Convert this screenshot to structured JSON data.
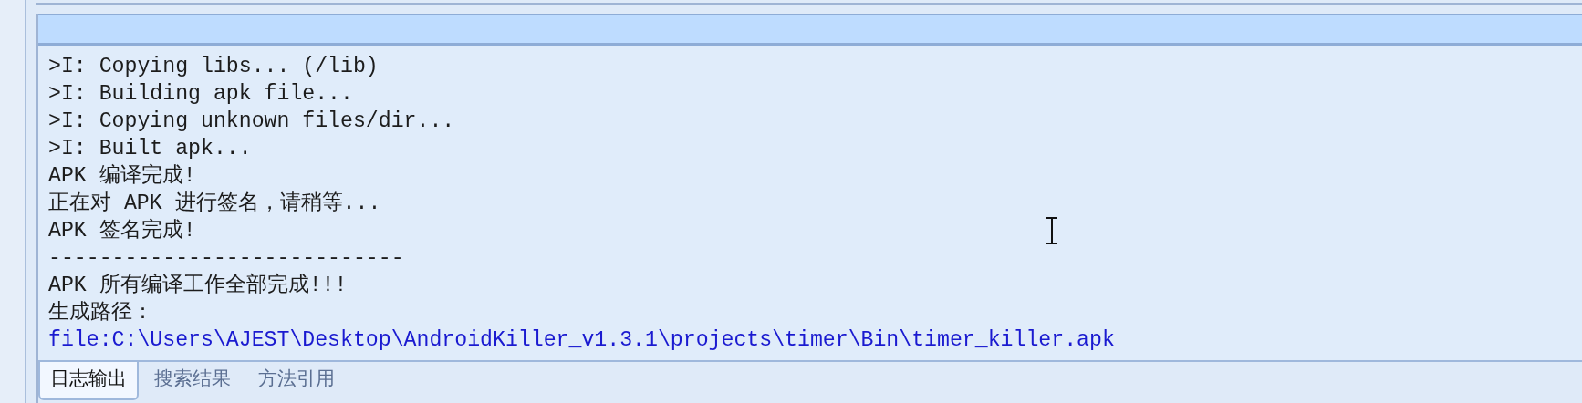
{
  "log": {
    "lines": [
      {
        "kind": "plain",
        "text": ">I: Copying libs... (/lib)"
      },
      {
        "kind": "plain",
        "text": ">I: Building apk file..."
      },
      {
        "kind": "plain",
        "text": ">I: Copying unknown files/dir..."
      },
      {
        "kind": "plain",
        "text": ">I: Built apk..."
      },
      {
        "kind": "plain",
        "text": "APK 编译完成!"
      },
      {
        "kind": "plain",
        "text": "正在对 APK 进行签名，请稍等..."
      },
      {
        "kind": "plain",
        "text": "APK 签名完成!"
      },
      {
        "kind": "plain",
        "text": "----------------------------"
      },
      {
        "kind": "plain",
        "text": "APK 所有编译工作全部完成!!!"
      },
      {
        "kind": "plain",
        "text": "生成路径："
      },
      {
        "kind": "link",
        "text": "file:C:\\Users\\AJEST\\Desktop\\AndroidKiller_v1.3.1\\projects\\timer\\Bin\\timer_killer.apk"
      }
    ]
  },
  "tabs": [
    {
      "label": "日志输出",
      "selected": true
    },
    {
      "label": "搜索结果",
      "selected": false
    },
    {
      "label": "方法引用",
      "selected": false
    }
  ]
}
